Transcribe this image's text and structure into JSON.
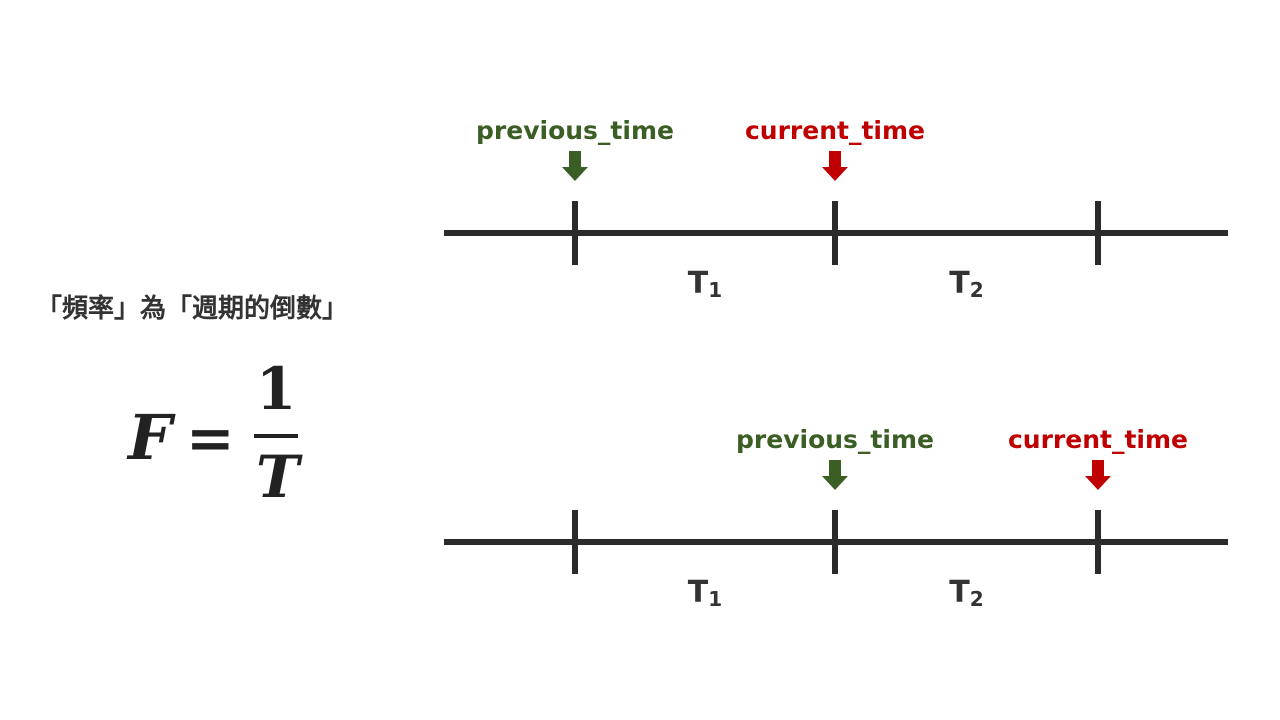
{
  "caption": "「頻率」為「週期的倒數」",
  "formula": {
    "lhs": "F",
    "eq": "=",
    "numerator": "1",
    "denominator": "T"
  },
  "colors": {
    "line": "#2b2b2b",
    "previous": "#3a5e23",
    "current": "#c00000",
    "text": "#333333"
  },
  "timelines": [
    {
      "markers": [
        {
          "label": "previous_time",
          "kind": "previous",
          "tick": 0
        },
        {
          "label": "current_time",
          "kind": "current",
          "tick": 1
        }
      ],
      "periods": [
        {
          "main": "T",
          "sub": "1"
        },
        {
          "main": "T",
          "sub": "2"
        }
      ]
    },
    {
      "markers": [
        {
          "label": "previous_time",
          "kind": "previous",
          "tick": 1
        },
        {
          "label": "current_time",
          "kind": "current",
          "tick": 2
        }
      ],
      "periods": [
        {
          "main": "T",
          "sub": "1"
        },
        {
          "main": "T",
          "sub": "2"
        }
      ]
    }
  ]
}
